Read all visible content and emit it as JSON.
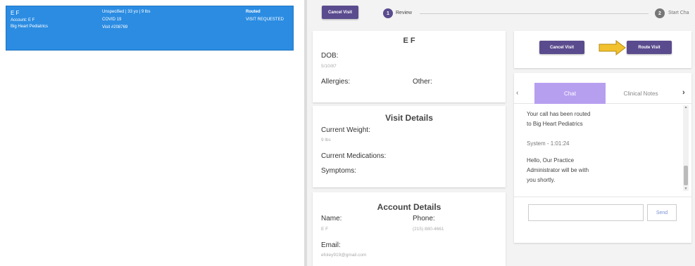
{
  "patient_card": {
    "name": "E F",
    "account": "Account: E F",
    "practice": "Big Heart Pediatrics",
    "demographics": "Unspecified | 33 yo | 9 lbs",
    "reason": "COVID 19",
    "visit_id": "Visit #208769",
    "status": "Routed",
    "status_detail": "VISIT REQUESTED"
  },
  "top_bar": {
    "cancel_label": "Cancel Visit",
    "step1_number": "1",
    "step1_label": "Review",
    "step2_number": "2",
    "step2_label": "Start Cha"
  },
  "patient_info": {
    "name": "E F",
    "dob_label": "DOB:",
    "dob_value": "5/10/87",
    "allergies_label": "Allergies:",
    "other_label": "Other:"
  },
  "visit_details": {
    "heading": "Visit Details",
    "weight_label": "Current Weight:",
    "weight_value": "9 lbs",
    "medications_label": "Current Medications:",
    "symptoms_label": "Symptoms:"
  },
  "account_details": {
    "heading": "Account Details",
    "name_label": "Name:",
    "name_value": "E F",
    "phone_label": "Phone:",
    "phone_value": "(215) 880-4661",
    "email_label": "Email:",
    "email_value": "efoley919@gmail.com"
  },
  "actions": {
    "cancel_label": "Cancel Visit",
    "route_label": "Route Visit"
  },
  "chat": {
    "tab_chat": "Chat",
    "tab_notes": "Clinical Notes",
    "msg1_line1": "Your call has been routed",
    "msg1_line2": "to Big Heart Pediatrics",
    "system_line": "System - 1:01:24",
    "msg2_line1": "Hello, Our Practice",
    "msg2_line2": "Administrator will be with",
    "msg2_line3": "you shortly.",
    "input_value": "",
    "send_label": "Send"
  },
  "colors": {
    "selected_card": "#2b8ce2",
    "purple": "#5a4b8e",
    "tab_active": "#b79ff0",
    "arrow": "#f2c12e"
  }
}
